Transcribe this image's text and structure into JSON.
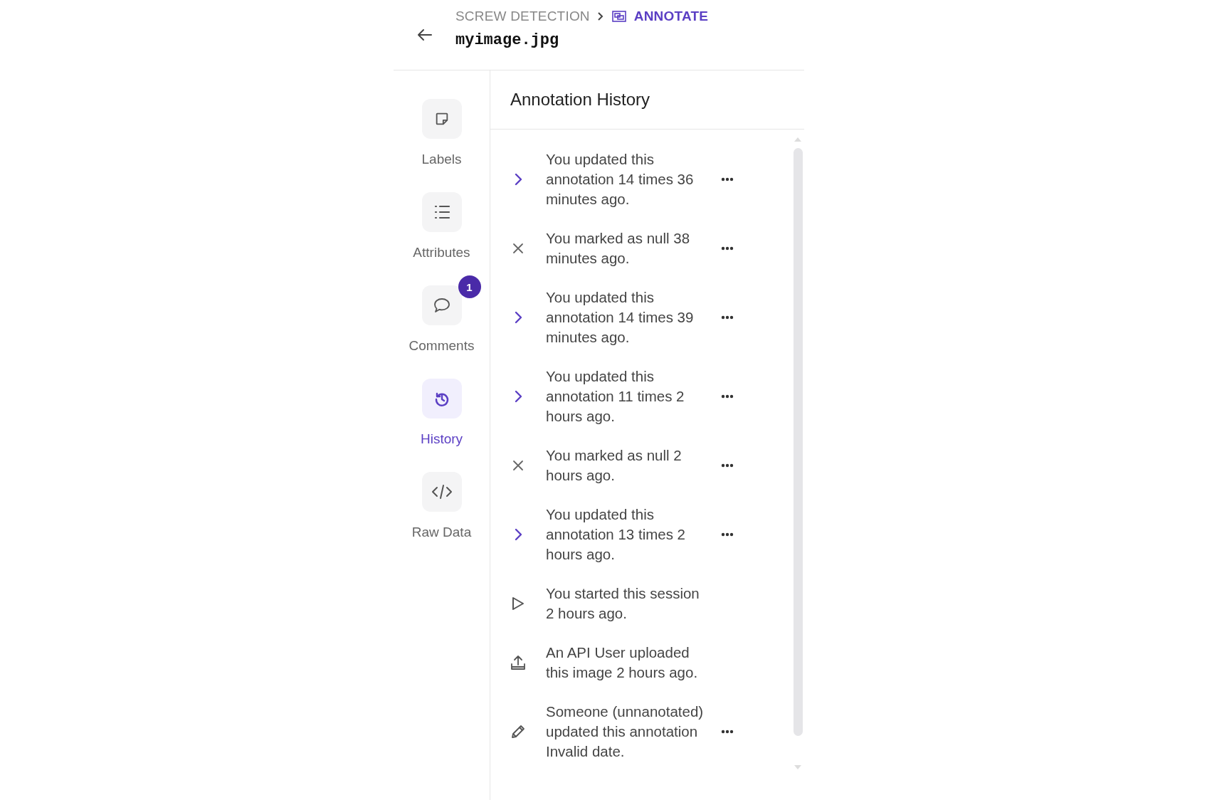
{
  "header": {
    "breadcrumb": [
      {
        "label": "SCREW DETECTION",
        "selected": false
      },
      {
        "label": "ANNOTATE",
        "selected": true
      }
    ],
    "filename": "myimage.jpg"
  },
  "sidebar": {
    "items": [
      {
        "kind": "labels",
        "label": "Labels",
        "selected": false
      },
      {
        "kind": "attributes",
        "label": "Attributes",
        "selected": false
      },
      {
        "kind": "comments",
        "label": "Comments",
        "selected": false,
        "badge": "1"
      },
      {
        "kind": "history",
        "label": "History",
        "selected": true
      },
      {
        "kind": "raw",
        "label": "Raw Data",
        "selected": false
      }
    ]
  },
  "panel": {
    "title": "Annotation History",
    "entries": [
      {
        "kind": "update",
        "text": "You updated this annotation 14 times 36 minutes ago.",
        "menu": true
      },
      {
        "kind": "null",
        "text": "You marked as null 38 minutes ago.",
        "menu": true
      },
      {
        "kind": "update",
        "text": "You updated this annotation 14 times 39 minutes ago.",
        "menu": true
      },
      {
        "kind": "update",
        "text": "You updated this annotation 11 times 2 hours ago.",
        "menu": true
      },
      {
        "kind": "null",
        "text": "You marked as null 2 hours ago.",
        "menu": true
      },
      {
        "kind": "update",
        "text": "You updated this annotation 13 times 2 hours ago.",
        "menu": true
      },
      {
        "kind": "start",
        "text": "You started this session 2 hours ago.",
        "menu": false
      },
      {
        "kind": "upload",
        "text": "An API User uploaded this image 2 hours ago.",
        "menu": false
      },
      {
        "kind": "edit",
        "text": "Someone (unnanotated) updated this annotation Invalid date.",
        "menu": true
      }
    ]
  }
}
